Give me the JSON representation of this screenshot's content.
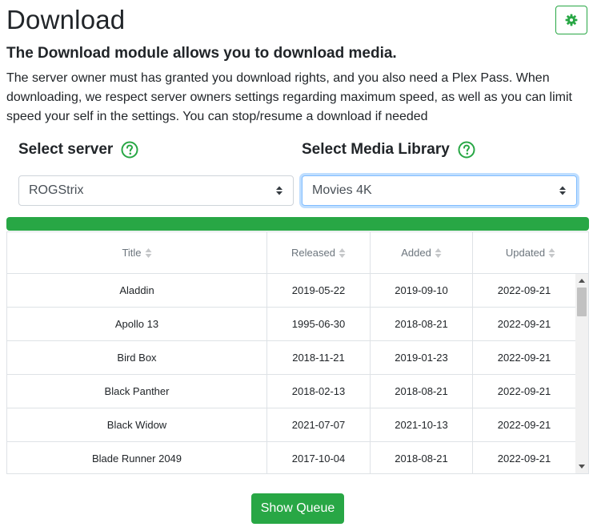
{
  "page": {
    "title": "Download",
    "subtitle": "The Download module allows you to download media.",
    "description": "The server owner must has granted you download rights, and you also need a Plex Pass. When downloading, we respect server owners settings regarding maximum speed, as well as you can limit speed your self in the settings. You can stop/resume a download if needed"
  },
  "settings_button": {
    "icon": "gear-icon"
  },
  "server_select": {
    "label": "Select server",
    "value": "ROGStrix",
    "help_icon": "question-circle-icon"
  },
  "library_select": {
    "label": "Select Media Library",
    "value": "Movies 4K",
    "help_icon": "question-circle-icon"
  },
  "progress": {
    "percent": 100
  },
  "table": {
    "columns": [
      "Title",
      "Released",
      "Added",
      "Updated"
    ],
    "rows": [
      [
        "Aladdin",
        "2019-05-22",
        "2019-09-10",
        "2022-09-21"
      ],
      [
        "Apollo 13",
        "1995-06-30",
        "2018-08-21",
        "2022-09-21"
      ],
      [
        "Bird Box",
        "2018-11-21",
        "2019-01-23",
        "2022-09-21"
      ],
      [
        "Black Panther",
        "2018-02-13",
        "2018-08-21",
        "2022-09-21"
      ],
      [
        "Black Widow",
        "2021-07-07",
        "2021-10-13",
        "2022-09-21"
      ],
      [
        "Blade Runner 2049",
        "2017-10-04",
        "2018-08-21",
        "2022-09-21"
      ]
    ]
  },
  "queue_button": {
    "label": "Show Queue"
  },
  "colors": {
    "accent": "#28a745",
    "focus": "#80bdff",
    "border": "#dee2e6"
  }
}
